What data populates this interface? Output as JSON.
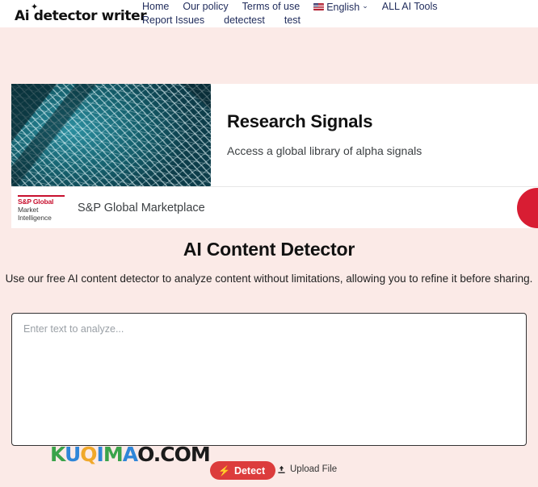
{
  "header": {
    "logo_text": "Ai detector writer",
    "logo_sparkle": "✦",
    "nav_row1": [
      {
        "label": "Home"
      },
      {
        "label": "Our policy"
      },
      {
        "label": "Terms of use"
      }
    ],
    "language": {
      "label": "English",
      "chevron": "⌄",
      "flag": "us-flag-icon"
    },
    "nav_row1_tail": [
      {
        "label": "ALL AI Tools"
      }
    ],
    "nav_row2": [
      {
        "label": "Report Issues"
      },
      {
        "label": "detectest"
      },
      {
        "label": "test"
      }
    ]
  },
  "ad": {
    "title": "Research Signals",
    "subtitle": "Access a global library of alpha signals",
    "image_alt": "school-of-fish-underwater",
    "brand": {
      "line1": "S&P Global",
      "line2": "Market",
      "line3": "Intelligence",
      "red": "#c8102e"
    },
    "advertiser": "S&P Global Marketplace",
    "circle_color": "#d81d33"
  },
  "main": {
    "title": "AI Content Detector",
    "subtitle": "Use our free AI content detector to analyze content without limitations, allowing you to refine it before sharing.",
    "textarea_placeholder": "Enter text to analyze...",
    "textarea_value": ""
  },
  "bottom": {
    "detect_label": "Detect",
    "detect_icon": "lightning-bolt-icon",
    "detect_color": "#dc3c3c",
    "upload_label": "Upload File",
    "upload_icon": "upload-icon",
    "watermark": {
      "letters": [
        {
          "ch": "K",
          "color": "#3aa34a"
        },
        {
          "ch": "U",
          "color": "#2f86d8"
        },
        {
          "ch": "Q",
          "color": "#f0a82a"
        },
        {
          "ch": "I",
          "color": "#2f86d8"
        },
        {
          "ch": "M",
          "color": "#3aa34a"
        },
        {
          "ch": "A",
          "color": "#2f86d8"
        },
        {
          "ch": "O",
          "color": "#1b1b1b"
        },
        {
          "ch": ".",
          "color": "#1b1b1b"
        },
        {
          "ch": "C",
          "color": "#1b1b1b"
        },
        {
          "ch": "O",
          "color": "#1b1b1b"
        },
        {
          "ch": "M",
          "color": "#1b1b1b"
        }
      ]
    }
  }
}
